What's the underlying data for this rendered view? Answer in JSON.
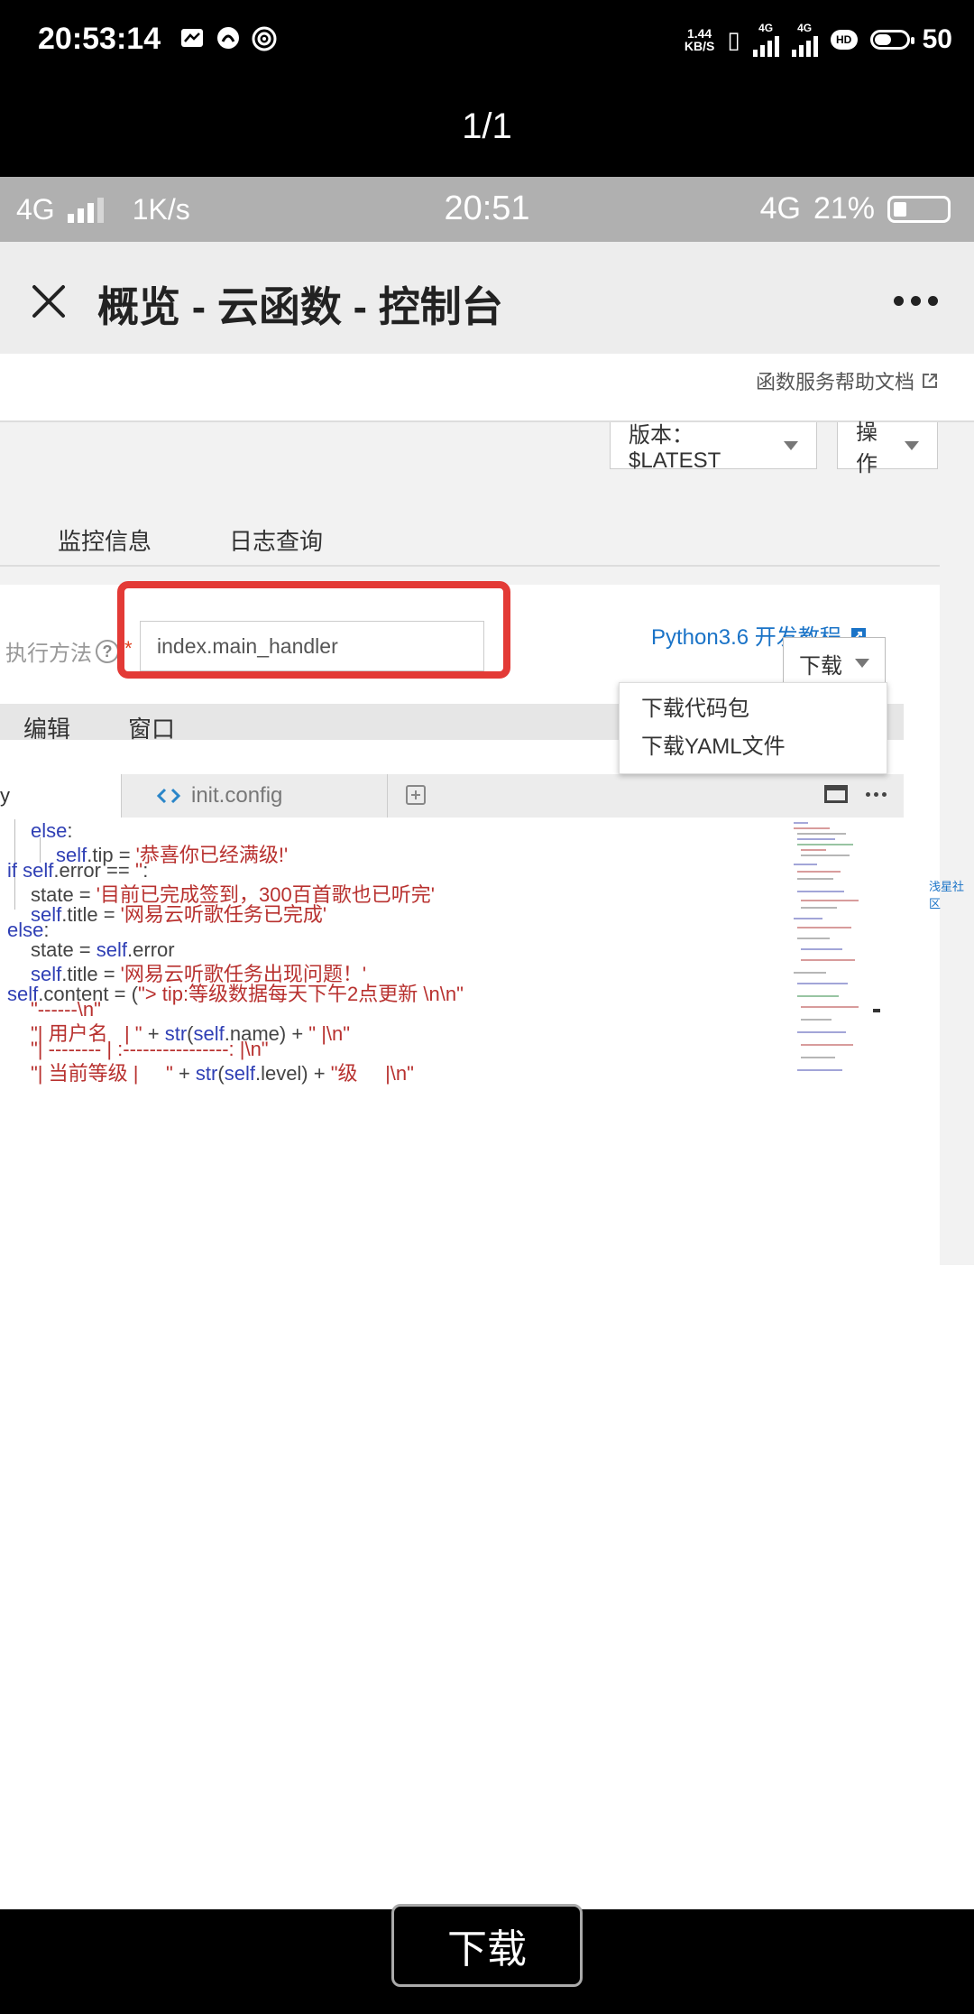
{
  "outer_status": {
    "time": "20:53:14",
    "net_speed_top": "1.44",
    "net_speed_unit": "KB/S",
    "net_type_1": "4G",
    "net_type_2": "4G",
    "battery": "50"
  },
  "page_counter": "1/1",
  "inner_status": {
    "network": "4G",
    "speed": "1K/s",
    "time": "20:51",
    "network_right": "4G",
    "battery": "21%"
  },
  "header": {
    "title": "概览 - 云函数 - 控制台"
  },
  "help_link": "函数服务帮助文档",
  "version_select": "版本：$LATEST",
  "action_select": "操作",
  "tabs": [
    {
      "label": "监控信息"
    },
    {
      "label": "日志查询"
    }
  ],
  "exec": {
    "label": "执行方法",
    "required": "*",
    "value": "index.main_handler"
  },
  "python_link": "Python3.6 开发教程",
  "download_btn": "下载",
  "download_menu": [
    {
      "label": "下载代码包"
    },
    {
      "label": "下载YAML文件"
    }
  ],
  "menu": {
    "edit": "编辑",
    "window": "窗口"
  },
  "editor_tabs": {
    "active": "y",
    "init": "init.config"
  },
  "side_link": "浅星社区",
  "bottom_download": "下载",
  "colors": {
    "accent": "#1a73c7",
    "highlight": "#e33a36",
    "keyword": "#2f3fb5",
    "string": "#b8312f"
  }
}
